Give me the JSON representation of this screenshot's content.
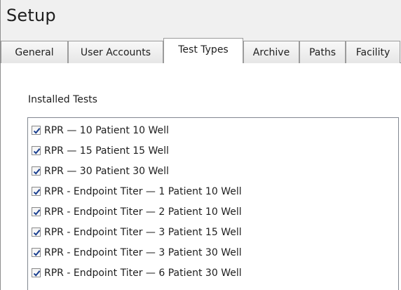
{
  "window": {
    "title": "Setup"
  },
  "tabs": [
    {
      "label": "General"
    },
    {
      "label": "User Accounts"
    },
    {
      "label": "Test Types",
      "active": true
    },
    {
      "label": "Archive"
    },
    {
      "label": "Paths"
    },
    {
      "label": "Facility"
    }
  ],
  "installed_tests": {
    "label": "Installed Tests",
    "items": [
      {
        "label": "RPR — 10 Patient 10 Well",
        "checked": true
      },
      {
        "label": "RPR — 15 Patient 15 Well",
        "checked": true
      },
      {
        "label": "RPR — 30 Patient 30 Well",
        "checked": true
      },
      {
        "label": "RPR - Endpoint Titer — 1 Patient 10 Well",
        "checked": true
      },
      {
        "label": "RPR - Endpoint Titer — 2 Patient 10 Well",
        "checked": true
      },
      {
        "label": "RPR - Endpoint Titer — 3 Patient 15 Well",
        "checked": true
      },
      {
        "label": "RPR - Endpoint Titer — 3 Patient 30 Well",
        "checked": true
      },
      {
        "label": "RPR - Endpoint Titer — 6 Patient 30 Well",
        "checked": true
      }
    ]
  },
  "colors": {
    "checkmark": "#1a3f8f",
    "border": "#8f8f8f",
    "panel": "#f0f0f0"
  },
  "icons": {
    "checkbox_checked": "checkmark-icon"
  }
}
